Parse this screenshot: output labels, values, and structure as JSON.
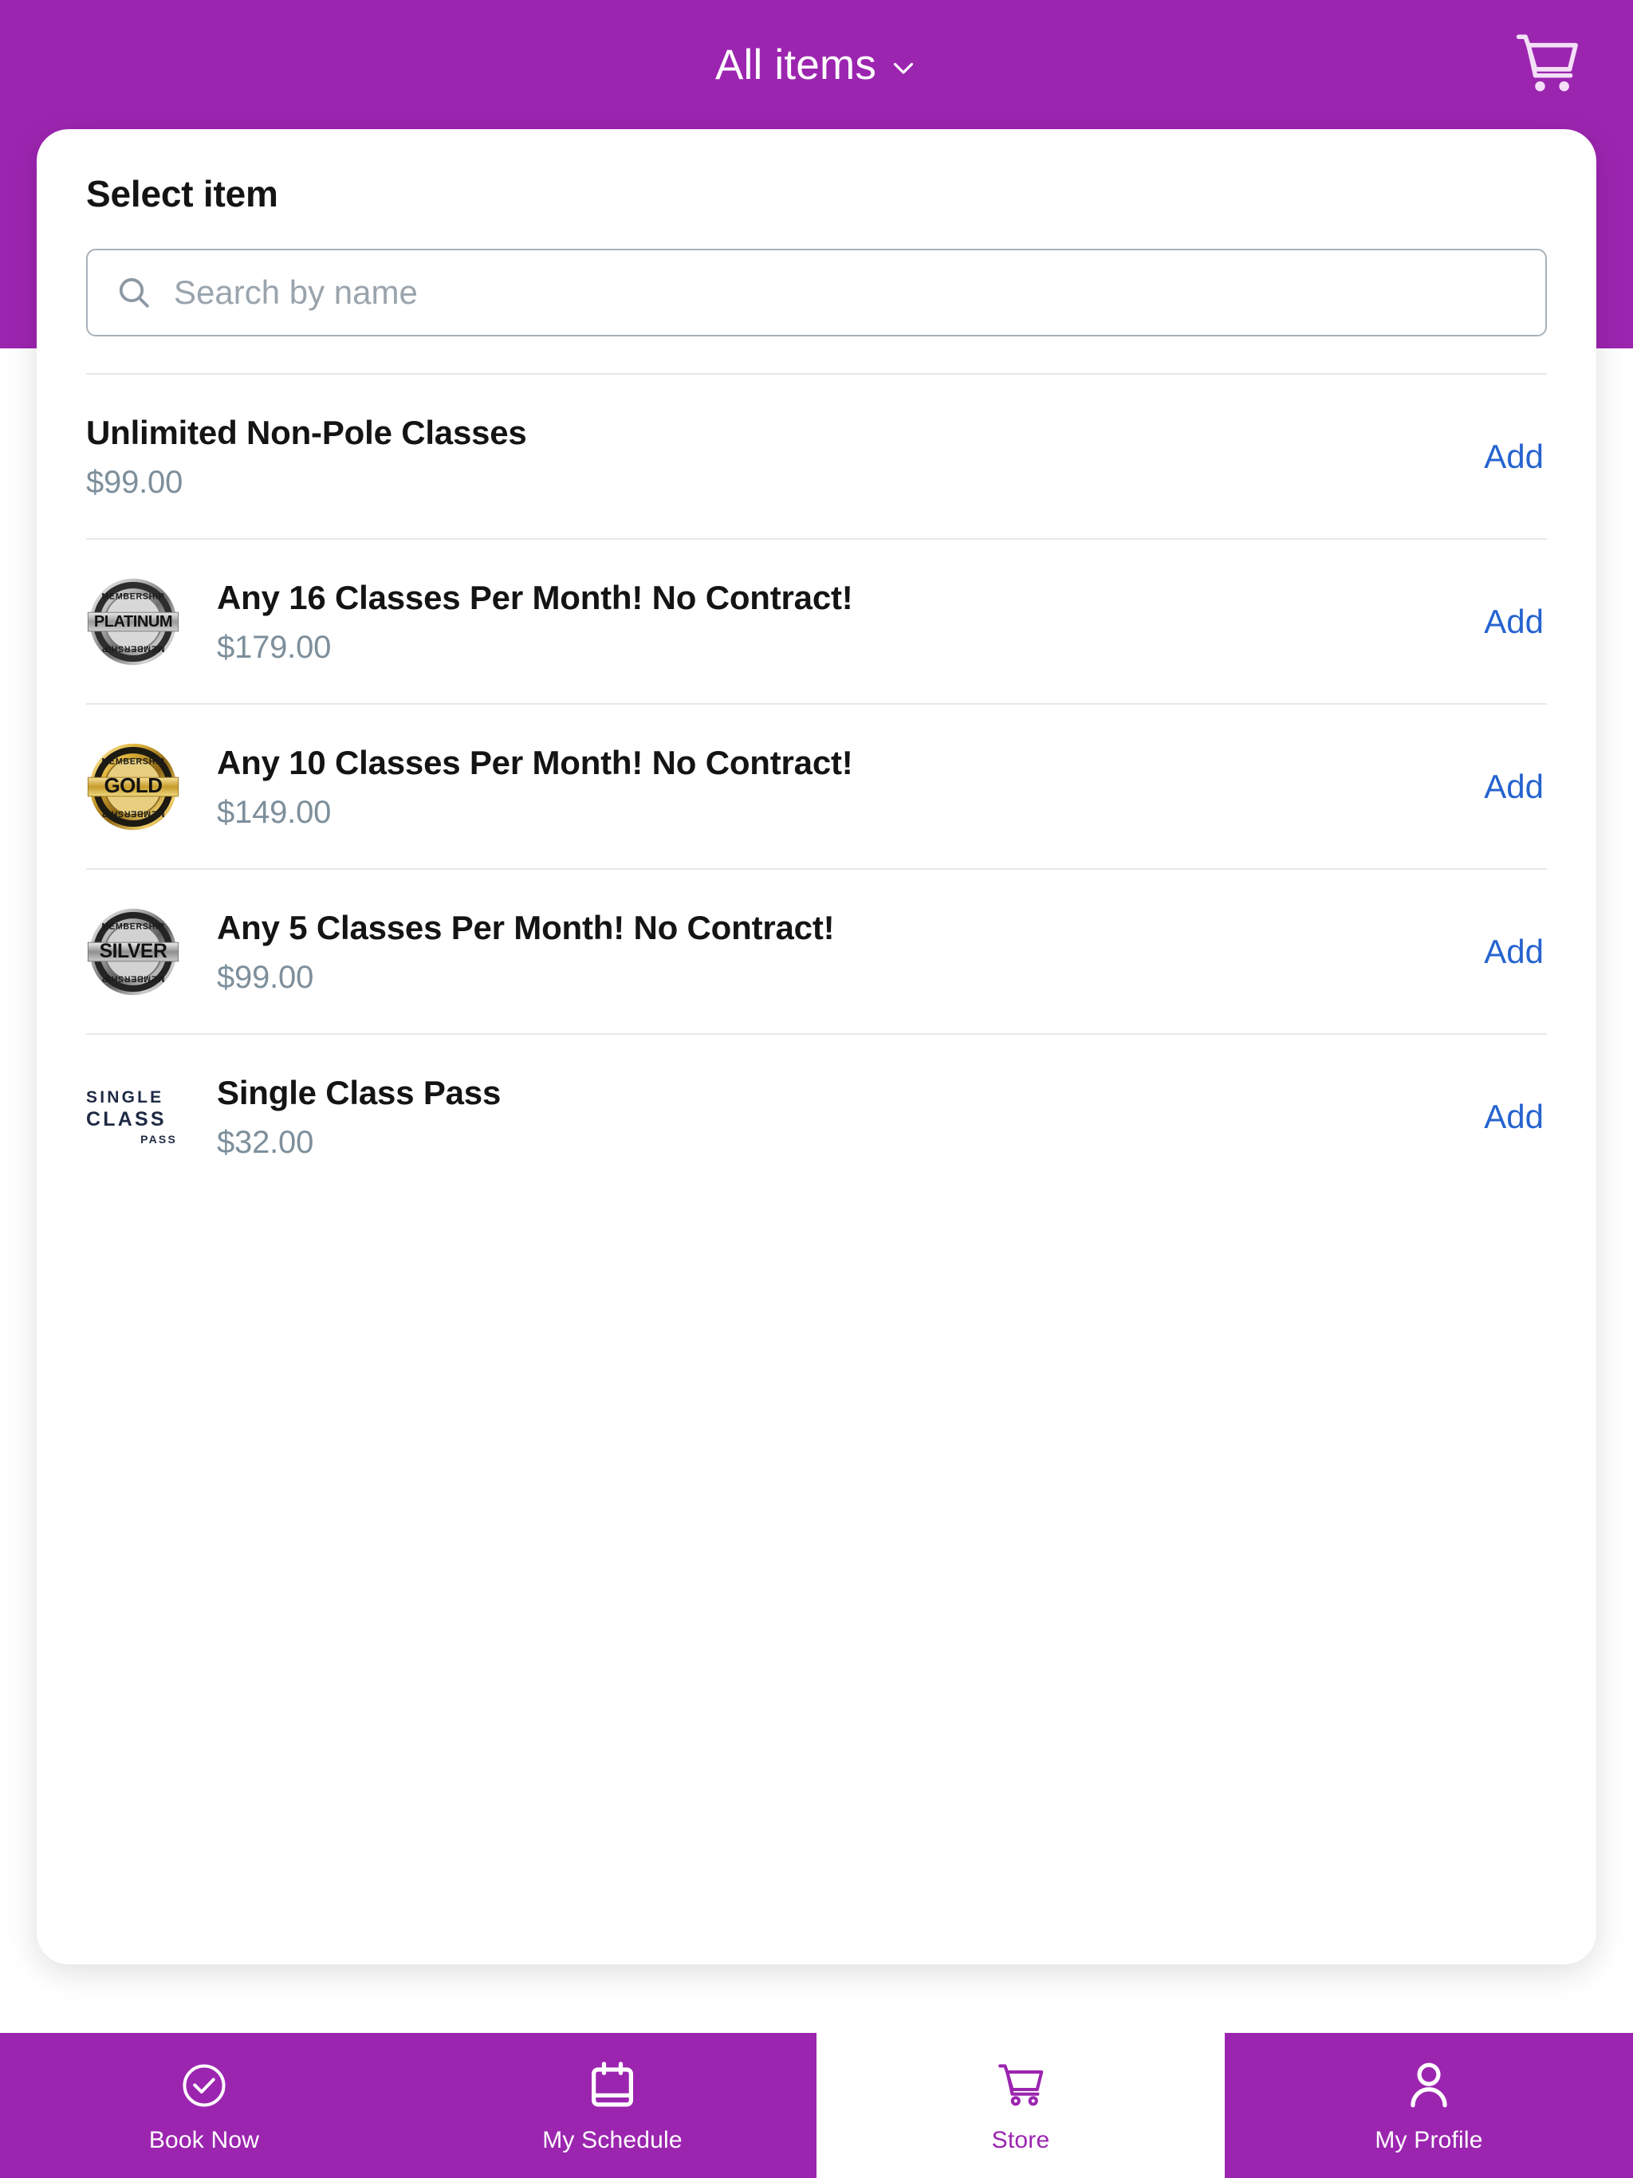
{
  "header": {
    "title": "All items",
    "chevron_icon": "chevron-down-icon",
    "cart_icon": "shopping-cart-icon"
  },
  "colors": {
    "brand_purple": "#9c25b0",
    "add_link_blue": "#2563cf",
    "price_gray": "#7d8f9b",
    "title_black": "#141414",
    "divider": "#e6e8ea"
  },
  "card": {
    "title": "Select item",
    "search": {
      "icon": "search-icon",
      "value": "",
      "placeholder": "Search by name"
    }
  },
  "items": [
    {
      "name": "Unlimited Non-Pole Classes",
      "price": "$99.00",
      "thumb": "none",
      "add_label": "Add"
    },
    {
      "name": "Any 16 Classes Per Month! No Contract!",
      "price": "$179.00",
      "thumb": "platinum-membership-badge-icon",
      "badge_text": "PLATINUM",
      "badge_ring_text": "MEMBERSHIP",
      "add_label": "Add"
    },
    {
      "name": "Any 10 Classes Per Month! No Contract!",
      "price": "$149.00",
      "thumb": "gold-membership-badge-icon",
      "badge_text": "GOLD",
      "badge_ring_text": "MEMBERSHIP",
      "add_label": "Add"
    },
    {
      "name": "Any 5 Classes Per Month! No Contract!",
      "price": "$99.00",
      "thumb": "silver-membership-badge-icon",
      "badge_text": "SILVER",
      "badge_ring_text": "MEMBERSHIP",
      "add_label": "Add"
    },
    {
      "name": "Single Class Pass",
      "price": "$32.00",
      "thumb": "single-class-pass-logo",
      "logo_line1": "SINGLE",
      "logo_line2": "CLASS",
      "logo_line3": "PASS",
      "add_label": "Add"
    }
  ],
  "bottom_nav": [
    {
      "label": "Book Now",
      "icon": "check-circle-icon",
      "active": false
    },
    {
      "label": "My Schedule",
      "icon": "calendar-icon",
      "active": false
    },
    {
      "label": "Store",
      "icon": "shopping-cart-icon",
      "active": true
    },
    {
      "label": "My Profile",
      "icon": "person-icon",
      "active": false
    }
  ]
}
